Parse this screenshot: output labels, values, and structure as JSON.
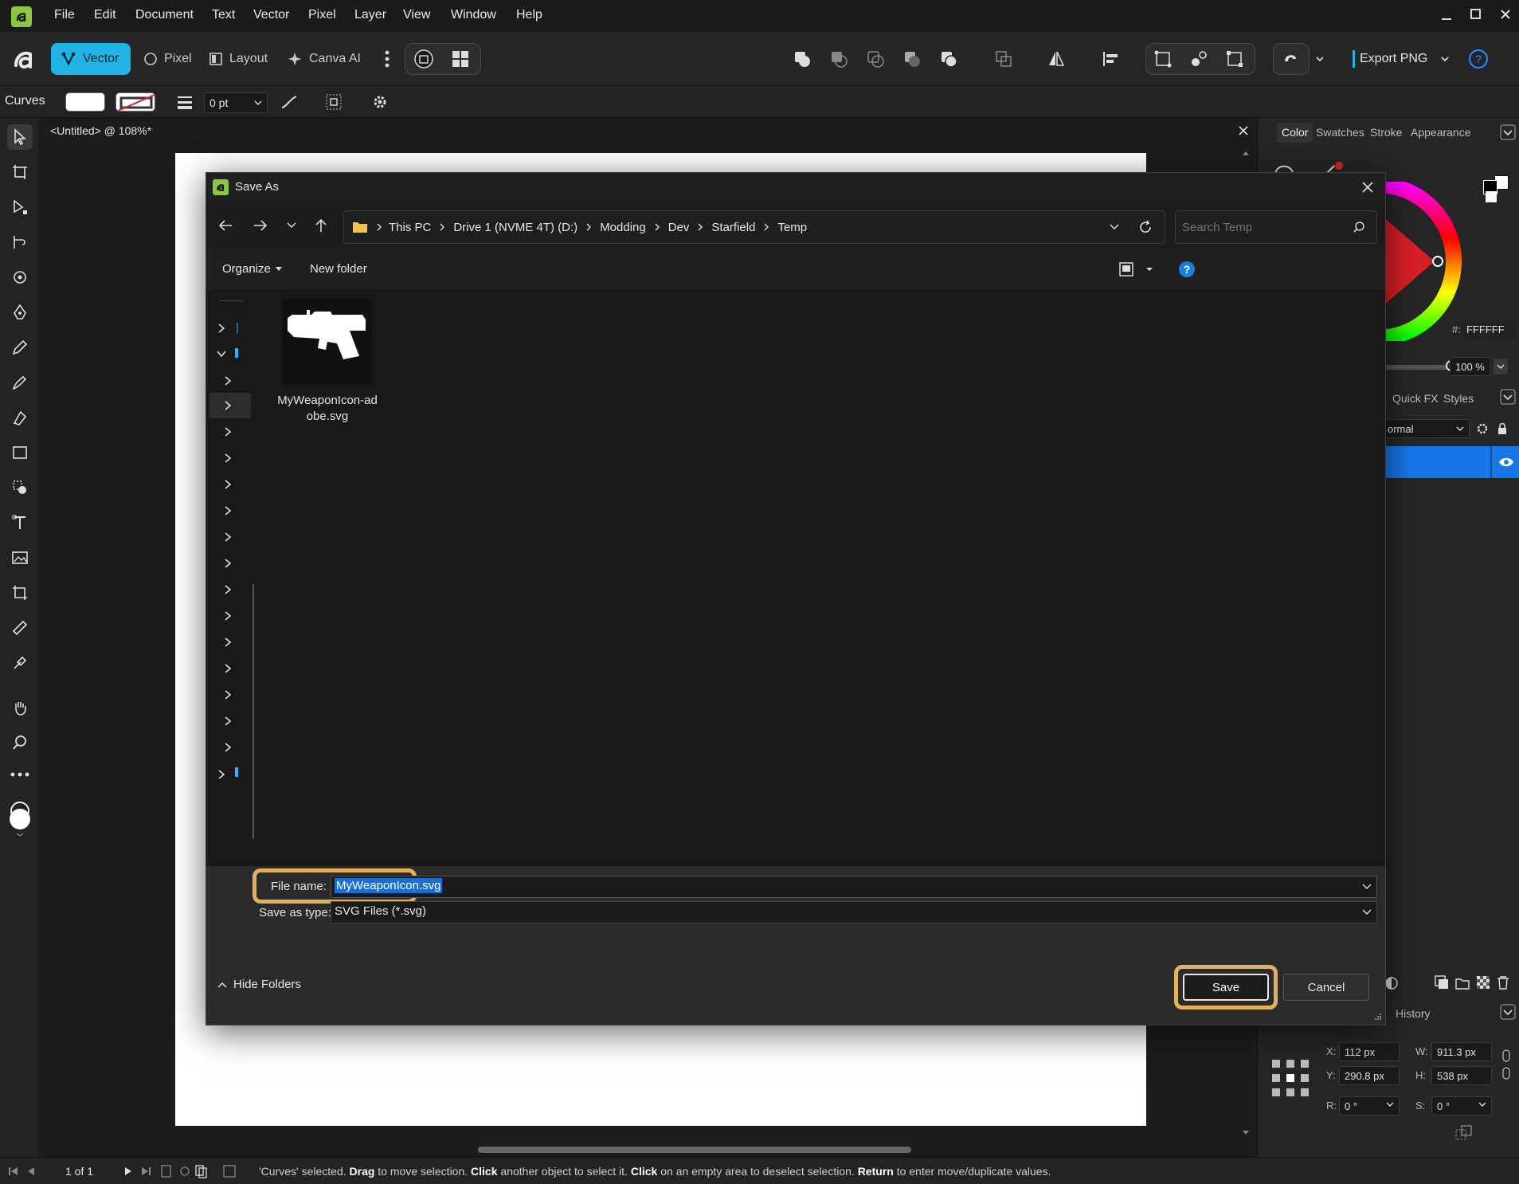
{
  "menubar": {
    "items": [
      "File",
      "Edit",
      "Document",
      "Text",
      "Vector",
      "Pixel",
      "Layer",
      "View",
      "Window",
      "Help"
    ]
  },
  "toolbar": {
    "personas": [
      "Vector",
      "Pixel",
      "Layout",
      "Canva AI"
    ],
    "export_label": "Export PNG"
  },
  "contextbar": {
    "tool_name": "Curves",
    "stroke_width": "0 pt"
  },
  "document": {
    "tab_title": "<Untitled> @ 108%*"
  },
  "dialog": {
    "title": "Save As",
    "breadcrumb": [
      "This PC",
      "Drive 1 (NVME 4T) (D:)",
      "Modding",
      "Dev",
      "Starfield",
      "Temp"
    ],
    "search_placeholder": "Search Temp",
    "organize_label": "Organize",
    "new_folder_label": "New folder",
    "files": [
      {
        "name": "MyWeaponIcon-adobe.svg"
      }
    ],
    "file_name_label": "File name:",
    "file_name_value": "MyWeaponIcon.svg",
    "save_type_label": "Save as type:",
    "save_type_value": "SVG Files (*.svg)",
    "hide_folders_label": "Hide Folders",
    "save_label": "Save",
    "cancel_label": "Cancel",
    "accent_highlight": "#e0b25a"
  },
  "rightpanel": {
    "tabs": [
      "Color",
      "Swatches",
      "Stroke",
      "Appearance"
    ],
    "hex_label": "#:",
    "hex_value": "FFFFFF",
    "opacity": "100 %",
    "fx_tabs": [
      "Quick FX",
      "Styles"
    ],
    "blend_mode": "ormal",
    "history_label": "History",
    "transform": {
      "x_label": "X:",
      "x": "112 px",
      "y_label": "Y:",
      "y": "290.8 px",
      "w_label": "W:",
      "w": "911.3 px",
      "h_label": "H:",
      "h": "538 px",
      "r_label": "R:",
      "r": "0 °",
      "s_label": "S:",
      "s": "0 °"
    }
  },
  "statusbar": {
    "page": "1 of 1",
    "message_parts": [
      {
        "text": "'Curves' selected. ",
        "bold": false
      },
      {
        "text": "Drag",
        "bold": true
      },
      {
        "text": " to move selection. ",
        "bold": false
      },
      {
        "text": "Click",
        "bold": true
      },
      {
        "text": " another object to select it. ",
        "bold": false
      },
      {
        "text": "Click",
        "bold": true
      },
      {
        "text": " on an empty area to deselect selection. ",
        "bold": false
      },
      {
        "text": "Return",
        "bold": true
      },
      {
        "text": " to enter move/duplicate values.",
        "bold": false
      }
    ]
  }
}
